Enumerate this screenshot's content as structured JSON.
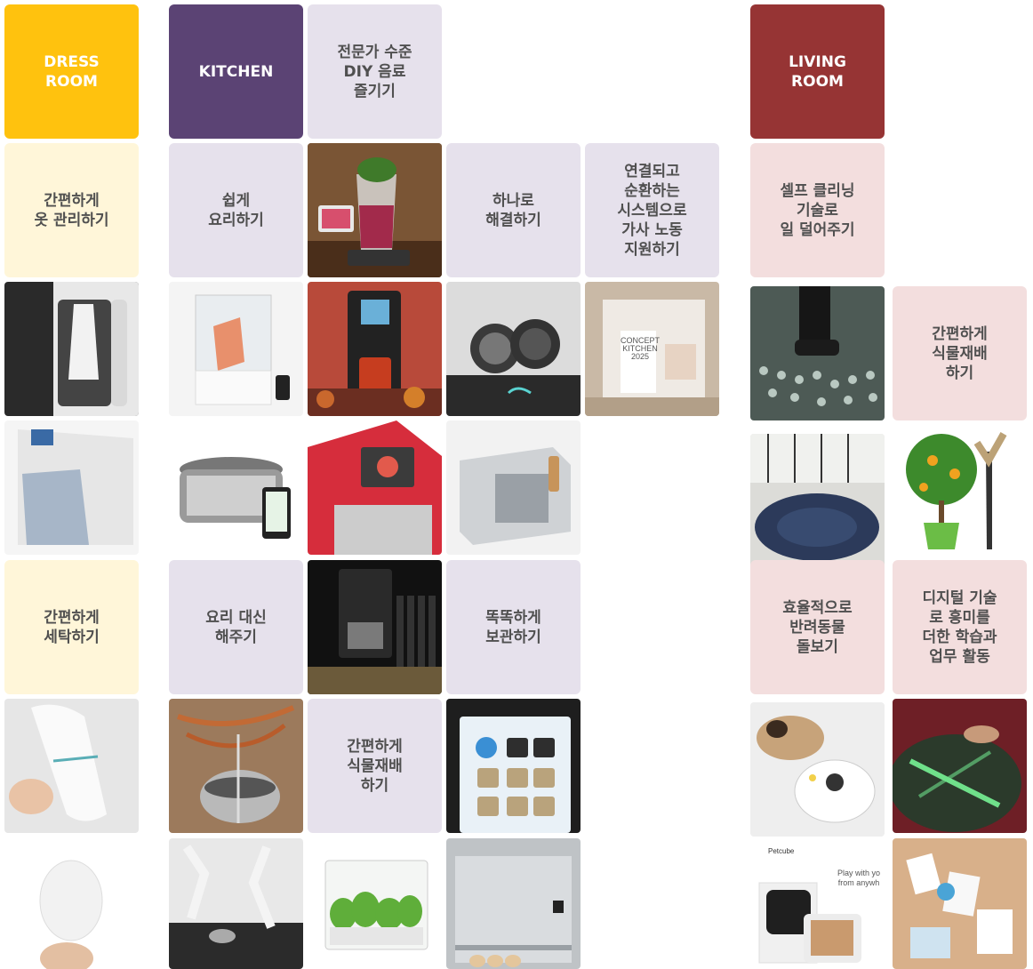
{
  "colors": {
    "dress_room": "#FFC20E",
    "kitchen": "#5B4374",
    "living_room": "#963434",
    "dress_label_bg": "#FFF6D9",
    "kitchen_label_bg": "#E6E1EC",
    "living_label_bg": "#F3DEDE",
    "label_text": "#505050"
  },
  "headers": {
    "dress_room": "DRESS\nROOM",
    "kitchen": "KITCHEN",
    "living_room": "LIVING\nROOM"
  },
  "labels": {
    "diy_drink": "전문가 수준\nDIY 음료\n즐기기",
    "easy_clothes": "간편하게\n옷 관리하기",
    "easy_cooking": "쉽게\n요리하기",
    "one_solution": "하나로\n해결하기",
    "connected_system": "연결되고\n순환하는\n시스템으로\n가사 노동\n지원하기",
    "self_cleaning": "셀프 클리닝\n기술로\n일 덜어주기",
    "living_plants": "간편하게\n식물재배\n하기",
    "easy_laundry": "간편하게\n세탁하기",
    "cook_for_you": "요리 대신\n해주기",
    "smart_storage": "똑똑하게\n보관하기",
    "pet_care": "효율적으로\n반려동물\n돌보기",
    "digital_learning": "디지털 기술\n로 흥미를\n더한 학습과\n업무 활동",
    "kitchen_plants": "간편하게\n식물재배\n하기"
  },
  "photos": {
    "blender": "blender-photo",
    "clothes_steamer": "clothes-steamer-photo",
    "sous_vide": "sous-vide-photo",
    "cocktail_machine": "cocktail-machine-photo",
    "robot_arm_cooker": "robot-arm-cooker-photo",
    "concept_kitchen": "concept-kitchen-photo",
    "moss_carpet": "moss-carpet-photo",
    "folding_machine": "folding-machine-photo",
    "slow_cooker": "slow-cooker-photo",
    "drink_dispenser": "drink-dispenser-photo",
    "heater_cube": "heater-cube-photo",
    "robot_vacuum_rug": "robot-vacuum-rug-photo",
    "smart_plant": "smart-plant-photo",
    "wine_dispenser": "wine-dispenser-photo",
    "handheld_steamer": "handheld-steamer-photo",
    "copper_still": "copper-still-photo",
    "fridge_screen": "fridge-screen-photo",
    "pet_ball": "pet-ball-photo",
    "projection_table": "projection-table-photo",
    "pebble_device": "pebble-device-photo",
    "robot_kitchen": "robot-kitchen-photo",
    "hydroponic_box": "hydroponic-box-photo",
    "fridge_eggs": "fridge-eggs-photo",
    "petcube": "petcube-photo",
    "petcube_brand": "Petcube",
    "petcube_tagline": "Play with yo\nfrom anywh",
    "learning_cards": "learning-cards-photo",
    "concept_kitchen_sign": "CONCEPT\nKITCHEN\n2025"
  }
}
